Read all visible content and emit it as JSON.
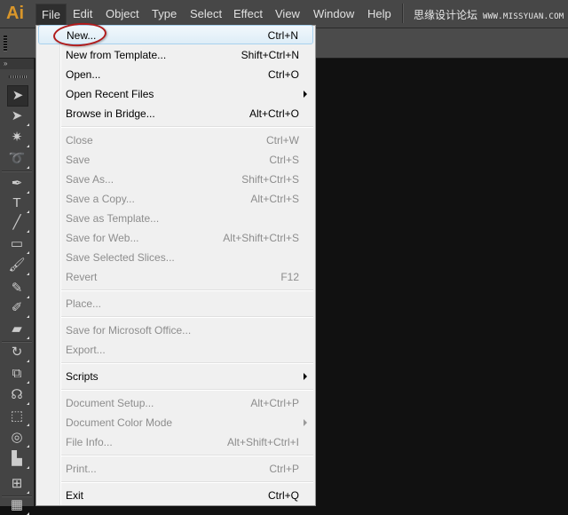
{
  "app": {
    "logo": "Ai"
  },
  "menubar": {
    "items": [
      {
        "label": "File",
        "active": true
      },
      {
        "label": "Edit"
      },
      {
        "label": "Object"
      },
      {
        "label": "Type"
      },
      {
        "label": "Select"
      },
      {
        "label": "Effect"
      },
      {
        "label": "View"
      },
      {
        "label": "Window"
      },
      {
        "label": "Help"
      }
    ],
    "watermark": {
      "text": "思缘设计论坛",
      "url": "WWW.MISSYUAN.COM"
    }
  },
  "toolbar": {
    "collapse_icon": "»",
    "tools": [
      {
        "name": "selection-tool",
        "glyph": "➤",
        "selected": true
      },
      {
        "name": "direct-selection-tool",
        "glyph": "➤"
      },
      {
        "name": "magic-wand-tool",
        "glyph": "✷"
      },
      {
        "name": "lasso-tool",
        "glyph": "➰"
      },
      {
        "name": "pen-tool",
        "glyph": "✒"
      },
      {
        "name": "type-tool",
        "glyph": "T"
      },
      {
        "name": "line-segment-tool",
        "glyph": "╱"
      },
      {
        "name": "rectangle-tool",
        "glyph": "▭"
      },
      {
        "name": "paintbrush-tool",
        "glyph": "🖌"
      },
      {
        "name": "pencil-tool",
        "glyph": "✎"
      },
      {
        "name": "blob-brush-tool",
        "glyph": "✐"
      },
      {
        "name": "eraser-tool",
        "glyph": "▰"
      },
      {
        "name": "rotate-tool",
        "glyph": "↻"
      },
      {
        "name": "scale-tool",
        "glyph": "⧉"
      },
      {
        "name": "warp-tool",
        "glyph": "☊"
      },
      {
        "name": "free-transform-tool",
        "glyph": "⬚"
      },
      {
        "name": "shape-builder-tool",
        "glyph": "◎"
      },
      {
        "name": "graph-tool",
        "glyph": "▙"
      },
      {
        "name": "mesh-tool",
        "glyph": "⊞"
      },
      {
        "name": "gradient-tool",
        "glyph": "▦"
      }
    ]
  },
  "file_menu": {
    "groups": [
      [
        {
          "label": "New...",
          "shortcut": "Ctrl+N",
          "enabled": true,
          "highlighted": true
        },
        {
          "label": "New from Template...",
          "shortcut": "Shift+Ctrl+N",
          "enabled": true
        },
        {
          "label": "Open...",
          "shortcut": "Ctrl+O",
          "enabled": true
        },
        {
          "label": "Open Recent Files",
          "shortcut": "",
          "enabled": true,
          "submenu": true
        },
        {
          "label": "Browse in Bridge...",
          "shortcut": "Alt+Ctrl+O",
          "enabled": true
        }
      ],
      [
        {
          "label": "Close",
          "shortcut": "Ctrl+W",
          "enabled": false
        },
        {
          "label": "Save",
          "shortcut": "Ctrl+S",
          "enabled": false
        },
        {
          "label": "Save As...",
          "shortcut": "Shift+Ctrl+S",
          "enabled": false
        },
        {
          "label": "Save a Copy...",
          "shortcut": "Alt+Ctrl+S",
          "enabled": false
        },
        {
          "label": "Save as Template...",
          "shortcut": "",
          "enabled": false
        },
        {
          "label": "Save for Web...",
          "shortcut": "Alt+Shift+Ctrl+S",
          "enabled": false
        },
        {
          "label": "Save Selected Slices...",
          "shortcut": "",
          "enabled": false
        },
        {
          "label": "Revert",
          "shortcut": "F12",
          "enabled": false
        }
      ],
      [
        {
          "label": "Place...",
          "shortcut": "",
          "enabled": false
        }
      ],
      [
        {
          "label": "Save for Microsoft Office...",
          "shortcut": "",
          "enabled": false
        },
        {
          "label": "Export...",
          "shortcut": "",
          "enabled": false
        }
      ],
      [
        {
          "label": "Scripts",
          "shortcut": "",
          "enabled": true,
          "submenu": true
        }
      ],
      [
        {
          "label": "Document Setup...",
          "shortcut": "Alt+Ctrl+P",
          "enabled": false
        },
        {
          "label": "Document Color Mode",
          "shortcut": "",
          "enabled": false,
          "submenu": true
        },
        {
          "label": "File Info...",
          "shortcut": "Alt+Shift+Ctrl+I",
          "enabled": false
        }
      ],
      [
        {
          "label": "Print...",
          "shortcut": "Ctrl+P",
          "enabled": false
        }
      ],
      [
        {
          "label": "Exit",
          "shortcut": "Ctrl+Q",
          "enabled": true
        }
      ]
    ]
  },
  "annotation": {
    "target": "New...",
    "color": "#b01b1b"
  }
}
